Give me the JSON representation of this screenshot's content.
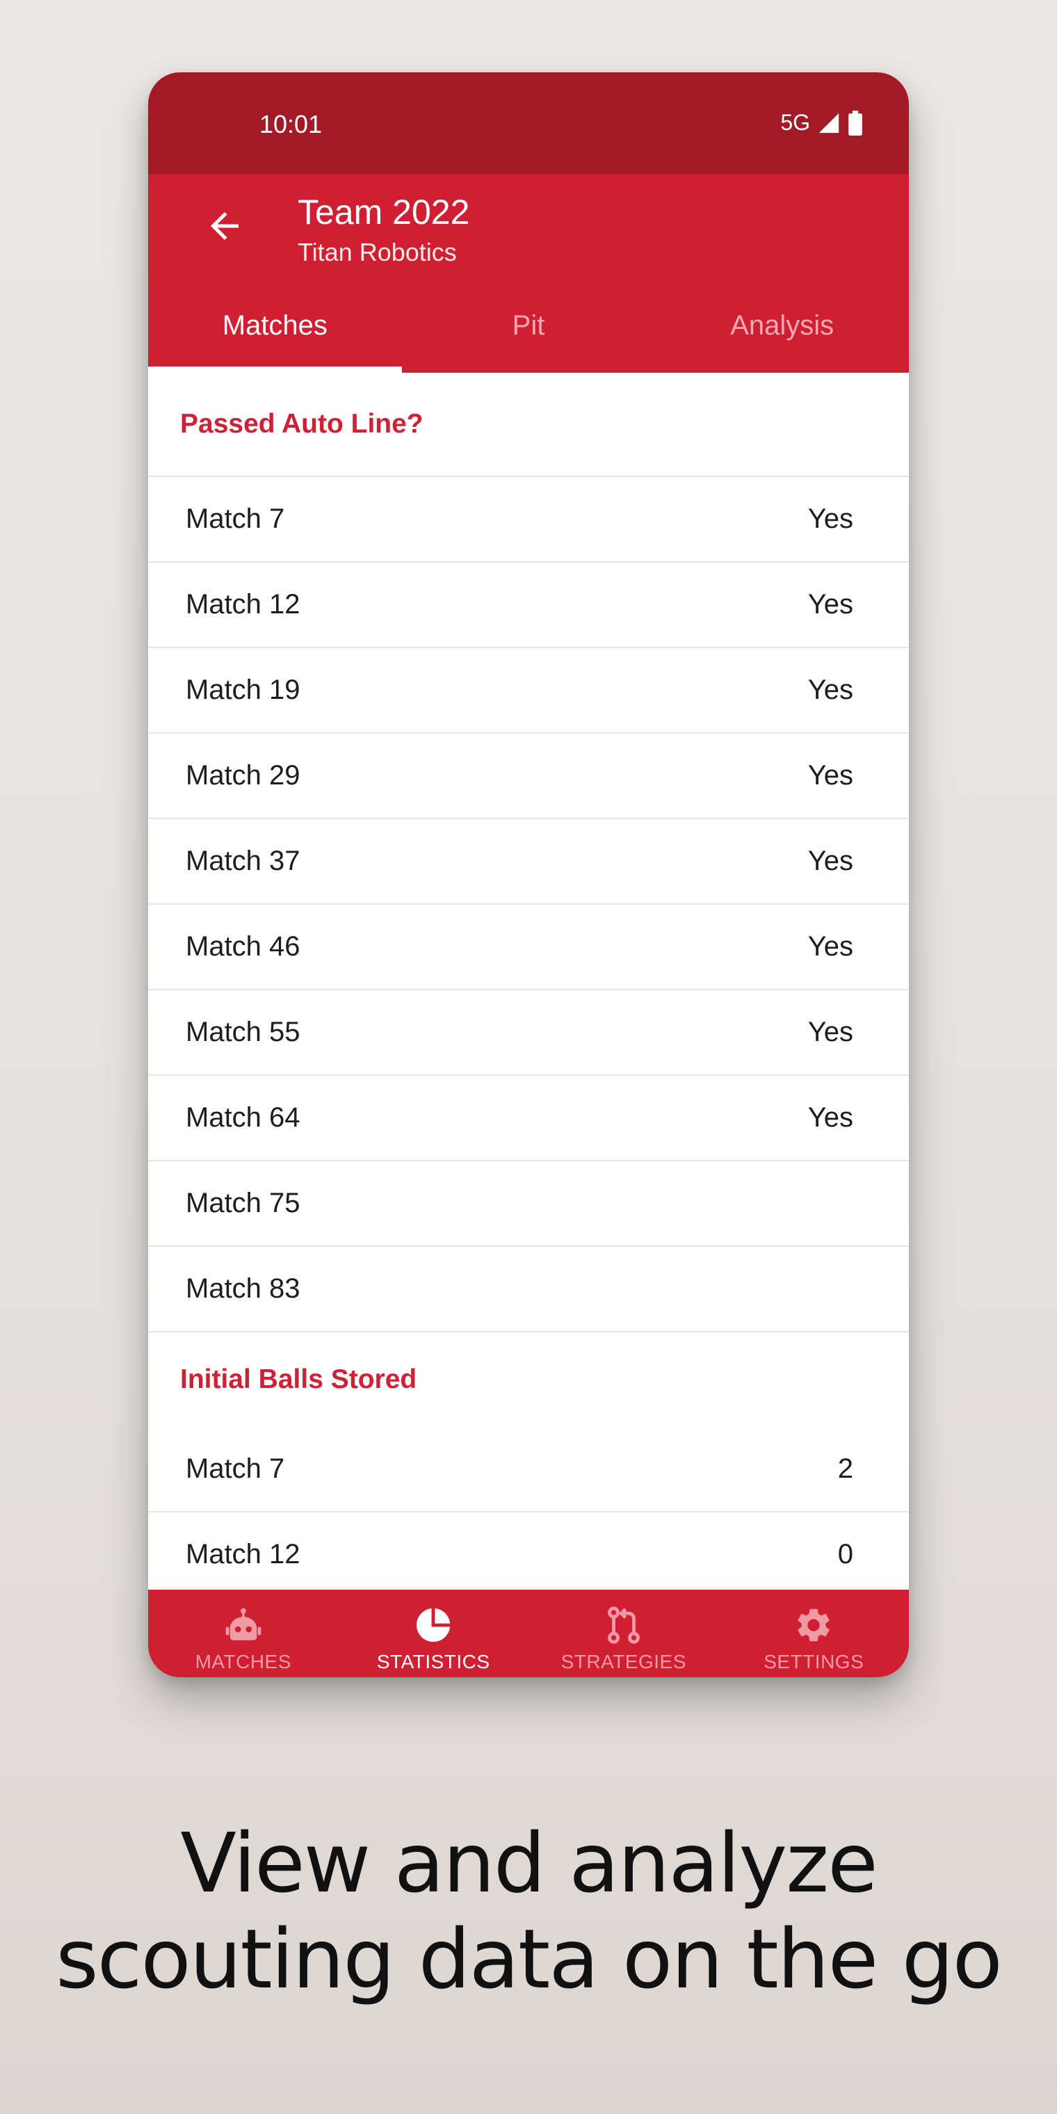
{
  "colors": {
    "primary": "#d01f33",
    "primary_dark": "#a31a27",
    "accent_text": "#cf2136"
  },
  "status_bar": {
    "time": "10:01",
    "network": "5G",
    "icons": [
      "signal-icon",
      "battery-icon"
    ]
  },
  "app_bar": {
    "title": "Team 2022",
    "subtitle": "Titan Robotics",
    "back_icon": "back-arrow-icon"
  },
  "tabs": [
    {
      "label": "Matches",
      "active": true
    },
    {
      "label": "Pit",
      "active": false
    },
    {
      "label": "Analysis",
      "active": false
    }
  ],
  "sections": [
    {
      "title": "Passed Auto Line?",
      "rows": [
        {
          "label": "Match 7",
          "value": "Yes"
        },
        {
          "label": "Match 12",
          "value": "Yes"
        },
        {
          "label": "Match 19",
          "value": "Yes"
        },
        {
          "label": "Match 29",
          "value": "Yes"
        },
        {
          "label": "Match 37",
          "value": "Yes"
        },
        {
          "label": "Match 46",
          "value": "Yes"
        },
        {
          "label": "Match 55",
          "value": "Yes"
        },
        {
          "label": "Match 64",
          "value": "Yes"
        },
        {
          "label": "Match 75",
          "value": ""
        },
        {
          "label": "Match 83",
          "value": ""
        }
      ]
    },
    {
      "title": "Initial Balls Stored",
      "rows": [
        {
          "label": "Match 7",
          "value": "2"
        },
        {
          "label": "Match 12",
          "value": "0"
        }
      ]
    }
  ],
  "bottom_nav": [
    {
      "label": "MATCHES",
      "icon": "robot-icon",
      "active": false
    },
    {
      "label": "STATISTICS",
      "icon": "pie-chart-icon",
      "active": true
    },
    {
      "label": "STRATEGIES",
      "icon": "pull-request-icon",
      "active": false
    },
    {
      "label": "SETTINGS",
      "icon": "gear-icon",
      "active": false
    }
  ],
  "caption": {
    "line1": "View and analyze",
    "line2": "scouting data on the go"
  }
}
